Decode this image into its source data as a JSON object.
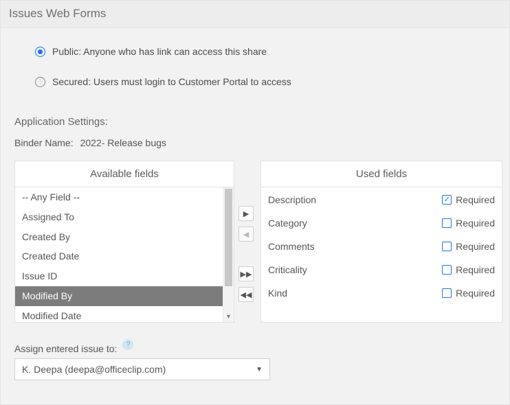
{
  "title": "Issues Web Forms",
  "access": {
    "public_label": "Public: Anyone who has link can access this share",
    "secured_label": "Secured: Users must login to Customer Portal to access",
    "selected": "public"
  },
  "settings_heading": "Application Settings:",
  "binder": {
    "label": "Binder Name:",
    "value": "2022- Release bugs"
  },
  "lists": {
    "available_header": "Available fields",
    "used_header": "Used fields",
    "available": [
      "-- Any Field --",
      "Assigned To",
      "Created By",
      "Created Date",
      "Issue ID",
      "Modified By",
      "Modified Date"
    ],
    "selected_available_index": 5,
    "used": [
      {
        "name": "Description",
        "required": true
      },
      {
        "name": "Category",
        "required": false
      },
      {
        "name": "Comments",
        "required": false
      },
      {
        "name": "Criticality",
        "required": false
      },
      {
        "name": "Kind",
        "required": false
      }
    ],
    "required_label": "Required"
  },
  "assign": {
    "label": "Assign entered issue to:",
    "value": "K. Deepa (deepa@officeclip.com)"
  }
}
